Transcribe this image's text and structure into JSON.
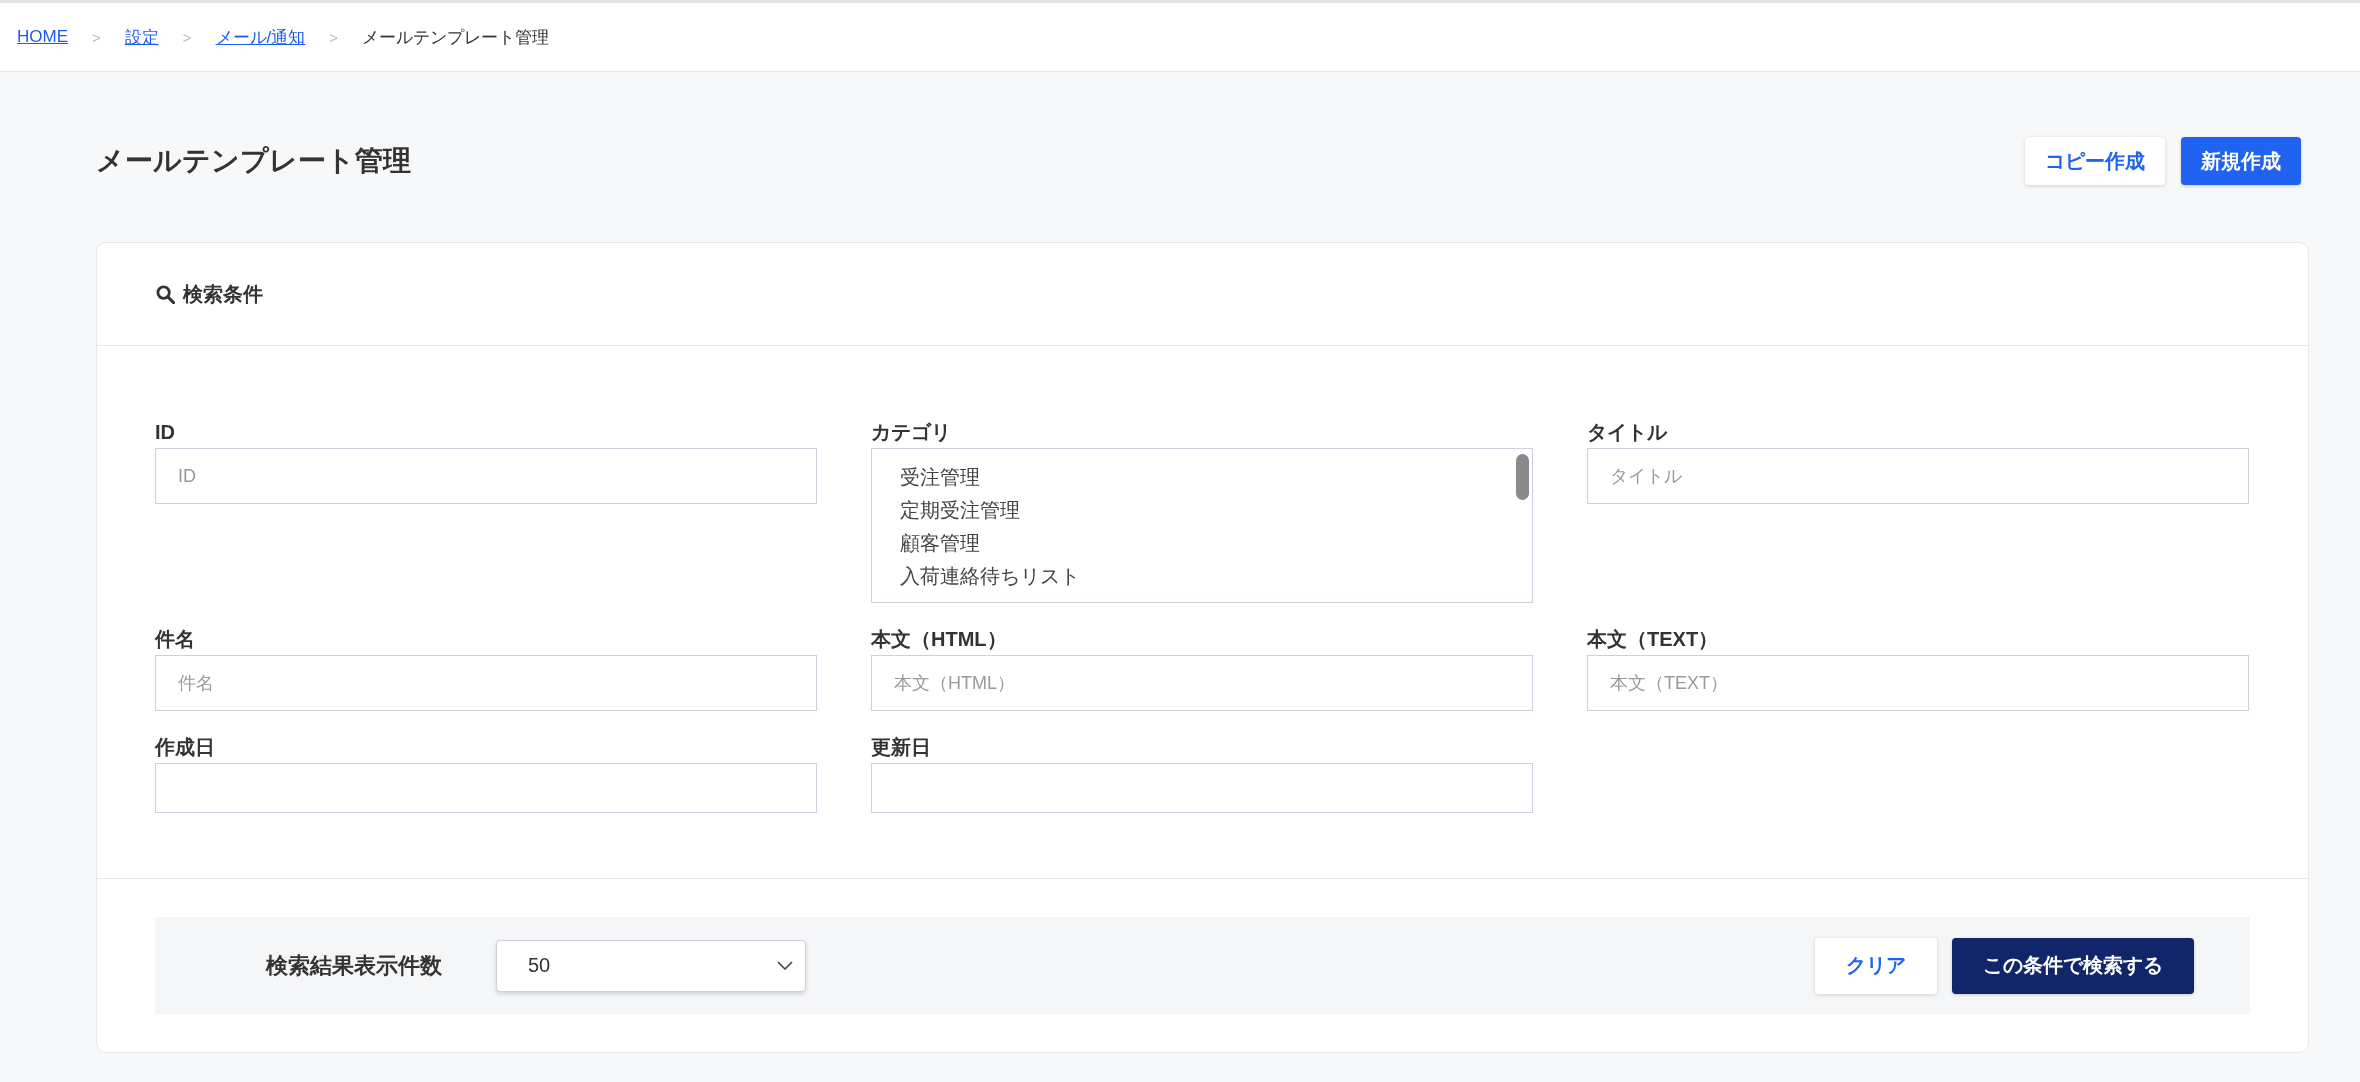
{
  "breadcrumb": [
    {
      "label": "HOME",
      "link": true,
      "separator": ">"
    },
    {
      "label": "設定",
      "link": true,
      "separator": ">"
    },
    {
      "label": "メール/通知",
      "link": true,
      "separator": ">"
    },
    {
      "label": "メールテンプレート管理",
      "link": false
    }
  ],
  "page": {
    "title": "メールテンプレート管理",
    "buttons": [
      {
        "label": "コピー作成",
        "kind": "secondary"
      },
      {
        "label": "新規作成",
        "kind": "primary"
      }
    ]
  },
  "search_panel": {
    "title": "検索条件",
    "fields": [
      {
        "label": "ID",
        "kind": "text",
        "placeholder": "ID"
      },
      {
        "label": "カテゴリ",
        "kind": "listbox",
        "options": [
          "受注管理",
          "定期受注管理",
          "顧客管理",
          "入荷連絡待ちリスト"
        ]
      },
      {
        "label": "タイトル",
        "kind": "text",
        "placeholder": "タイトル"
      },
      {
        "label": "件名",
        "kind": "text",
        "placeholder": "件名"
      },
      {
        "label": "本文（HTML）",
        "kind": "text",
        "placeholder": "本文（HTML）"
      },
      {
        "label": "本文（TEXT）",
        "kind": "text",
        "placeholder": "本文（TEXT）"
      },
      {
        "label": "作成日",
        "kind": "date"
      },
      {
        "label": "更新日",
        "kind": "date"
      }
    ],
    "footer": {
      "page_size_label": "検索結果表示件数",
      "page_size": {
        "value": "50"
      },
      "buttons": [
        {
          "label": "クリア",
          "kind": "secondary"
        },
        {
          "label": "この条件で検索する",
          "kind": "primary"
        }
      ]
    }
  }
}
